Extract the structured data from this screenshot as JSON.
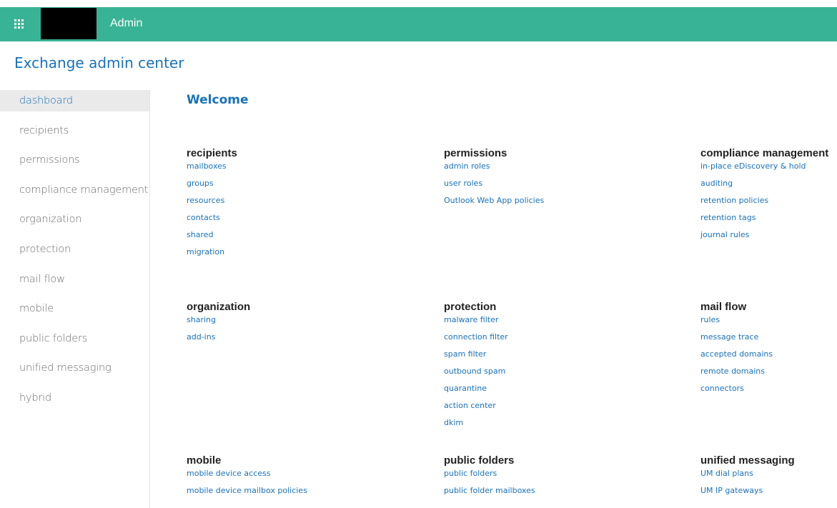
{
  "header": {
    "app_title": "Admin",
    "bar_color": "#39b395"
  },
  "page": {
    "title": "Exchange admin center",
    "welcome": "Welcome"
  },
  "sidebar": {
    "items": [
      {
        "label": "dashboard",
        "active": true
      },
      {
        "label": "recipients"
      },
      {
        "label": "permissions"
      },
      {
        "label": "compliance management"
      },
      {
        "label": "organization"
      },
      {
        "label": "protection"
      },
      {
        "label": "mail flow"
      },
      {
        "label": "mobile"
      },
      {
        "label": "public folders"
      },
      {
        "label": "unified messaging"
      },
      {
        "label": "hybrid"
      }
    ]
  },
  "sections": [
    {
      "heading": "recipients",
      "links": [
        "mailboxes",
        "groups",
        "resources",
        "contacts",
        "shared",
        "migration"
      ]
    },
    {
      "heading": "permissions",
      "links": [
        "admin roles",
        "user roles",
        "Outlook Web App policies"
      ]
    },
    {
      "heading": "compliance management",
      "links": [
        "in-place eDiscovery & hold",
        "auditing",
        "retention policies",
        "retention tags",
        "journal rules"
      ]
    },
    {
      "heading": "organization",
      "links": [
        "sharing",
        "add-ins"
      ]
    },
    {
      "heading": "protection",
      "links": [
        "malware filter",
        "connection filter",
        "spam filter",
        "outbound spam",
        "quarantine",
        "action center",
        "dkim"
      ]
    },
    {
      "heading": "mail flow",
      "links": [
        "rules",
        "message trace",
        "accepted domains",
        "remote domains",
        "connectors"
      ]
    },
    {
      "heading": "mobile",
      "links": [
        "mobile device access",
        "mobile device mailbox policies"
      ]
    },
    {
      "heading": "public folders",
      "links": [
        "public folders",
        "public folder mailboxes"
      ]
    },
    {
      "heading": "unified messaging",
      "links": [
        "UM dial plans",
        "UM IP gateways"
      ]
    }
  ]
}
